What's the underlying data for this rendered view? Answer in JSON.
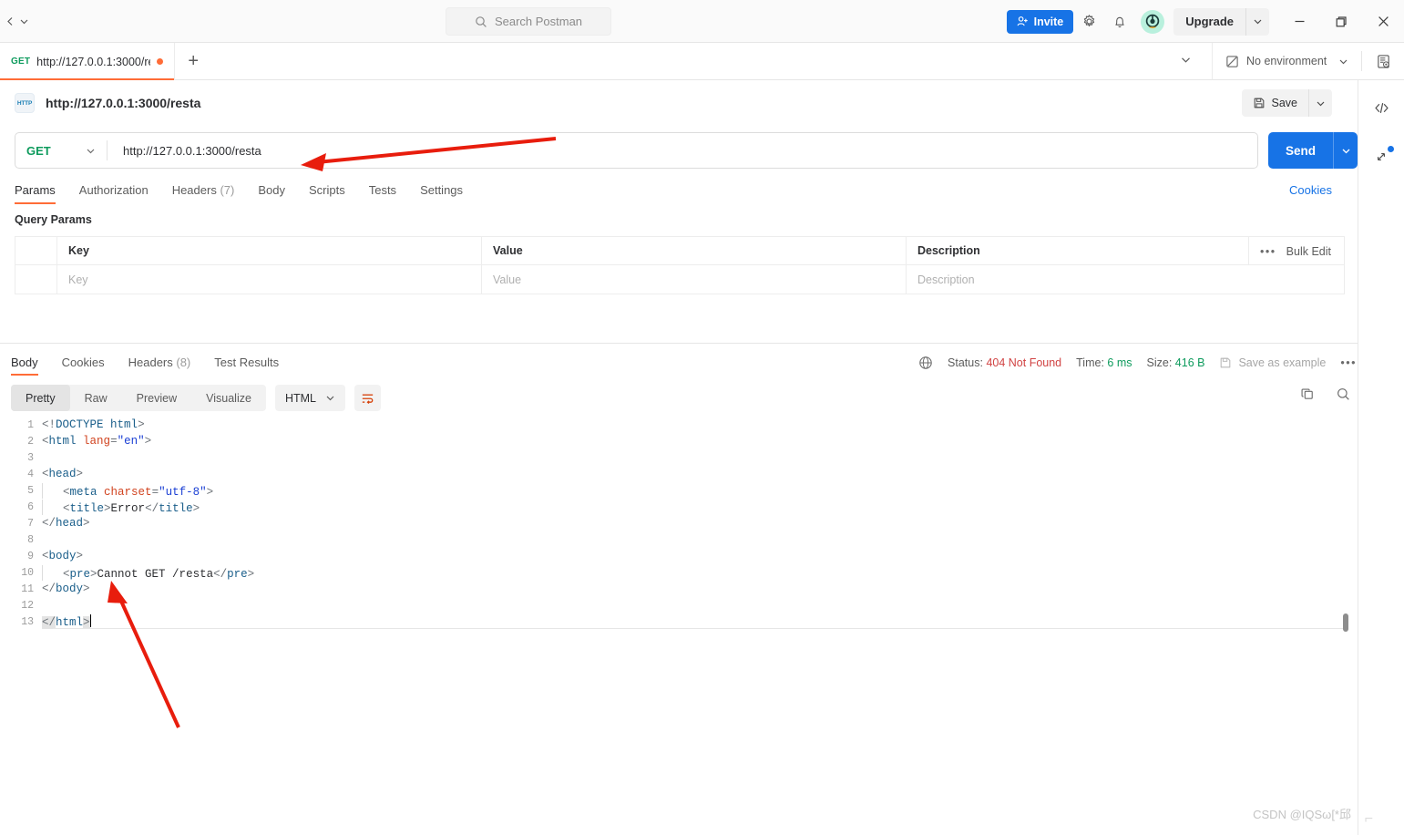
{
  "topbar": {
    "search_placeholder": "Search Postman",
    "invite_label": "Invite",
    "upgrade_label": "Upgrade",
    "icons": {
      "back": "chevron-left-icon",
      "history": "chevron-down-icon",
      "search": "search-icon",
      "settings": "gear-icon",
      "notifications": "bell-icon",
      "minimize": "minimize-icon",
      "maximize": "maximize-icon",
      "close": "close-icon"
    }
  },
  "tabstrip": {
    "tabs": [
      {
        "method": "GET",
        "name": "http://127.0.0.1:3000/re:",
        "unsaved": true
      }
    ],
    "new_tab_label": "+"
  },
  "environment": {
    "selected": "No environment"
  },
  "request": {
    "protocol_badge": "HTTP",
    "title": "http://127.0.0.1:3000/resta",
    "save_label": "Save",
    "method": "GET",
    "url": "http://127.0.0.1:3000/resta",
    "send_label": "Send",
    "tabs": [
      {
        "label": "Params",
        "count": "",
        "active": true
      },
      {
        "label": "Authorization",
        "count": "",
        "active": false
      },
      {
        "label": "Headers",
        "count": "(7)",
        "active": false
      },
      {
        "label": "Body",
        "count": "",
        "active": false
      },
      {
        "label": "Scripts",
        "count": "",
        "active": false
      },
      {
        "label": "Tests",
        "count": "",
        "active": false
      },
      {
        "label": "Settings",
        "count": "",
        "active": false
      }
    ],
    "cookies_link": "Cookies"
  },
  "query_params": {
    "section_title": "Query Params",
    "columns": [
      "Key",
      "Value",
      "Description"
    ],
    "rows": [
      {
        "key": "Key",
        "value": "Value",
        "description": "Description"
      }
    ],
    "bulk_edit_label": "Bulk Edit",
    "more_label": "•••"
  },
  "response": {
    "tabs": [
      {
        "label": "Body",
        "count": "",
        "active": true
      },
      {
        "label": "Cookies",
        "count": "",
        "active": false
      },
      {
        "label": "Headers",
        "count": "(8)",
        "active": false
      },
      {
        "label": "Test Results",
        "count": "",
        "active": false
      }
    ],
    "status_label": "Status:",
    "status_value": "404 Not Found",
    "time_label": "Time:",
    "time_value": "6 ms",
    "size_label": "Size:",
    "size_value": "416 B",
    "save_example_label": "Save as example",
    "more_label": "•••",
    "view_modes": [
      {
        "label": "Pretty",
        "active": true
      },
      {
        "label": "Raw",
        "active": false
      },
      {
        "label": "Preview",
        "active": false
      },
      {
        "label": "Visualize",
        "active": false
      }
    ],
    "format": "HTML",
    "wrap_icon": "word-wrap-icon",
    "copy_icon": "copy-icon",
    "search_icon": "search-icon",
    "body_lines": [
      {
        "n": "1",
        "text": "<!DOCTYPE html>"
      },
      {
        "n": "2",
        "text": "<html lang=\"en\">"
      },
      {
        "n": "3",
        "text": ""
      },
      {
        "n": "4",
        "text": "<head>"
      },
      {
        "n": "5",
        "text": "    <meta charset=\"utf-8\">"
      },
      {
        "n": "6",
        "text": "    <title>Error</title>"
      },
      {
        "n": "7",
        "text": "</head>"
      },
      {
        "n": "8",
        "text": ""
      },
      {
        "n": "9",
        "text": "<body>"
      },
      {
        "n": "10",
        "text": "    <pre>Cannot GET /resta</pre>"
      },
      {
        "n": "11",
        "text": "</body>"
      },
      {
        "n": "12",
        "text": ""
      },
      {
        "n": "13",
        "text": "</html>"
      }
    ]
  },
  "rail": {
    "items": [
      "code-snippet-icon",
      "expand-arrows-icon"
    ]
  },
  "watermark": {
    "text": "CSDN @ΙQSω[*邱"
  },
  "colors": {
    "accent_orange": "#ff6c37",
    "primary_blue": "#1773e6",
    "method_green": "#0e9b5d",
    "error_red": "#d14343",
    "annotation_red": "#e81d0d"
  }
}
